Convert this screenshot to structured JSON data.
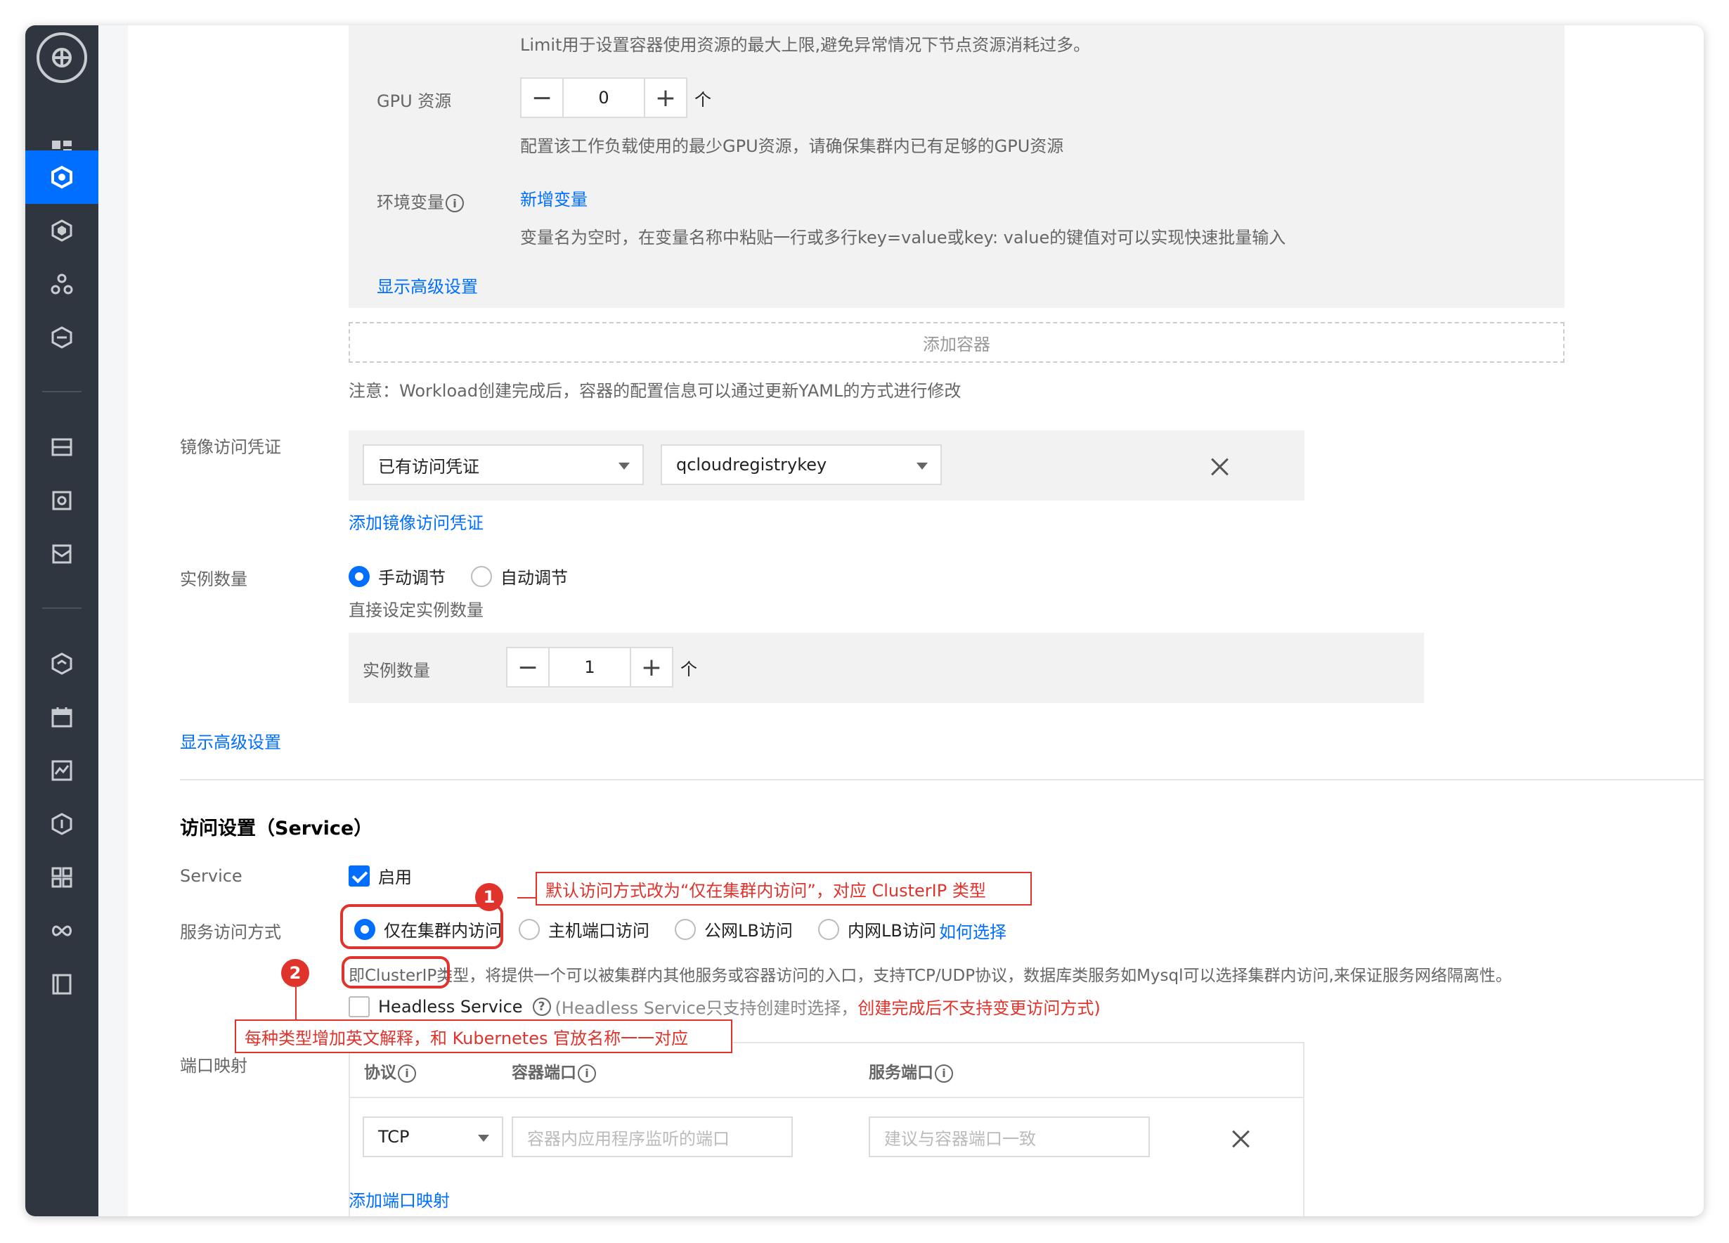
{
  "container": {
    "limit_note": "Limit用于设置容器使用资源的最大上限,避免异常情况下节点资源消耗过多。",
    "gpu_label": "GPU 资源",
    "gpu_value": "0",
    "gpu_unit": "个",
    "gpu_note": "配置该工作负载使用的最少GPU资源，请确保集群内已有足够的GPU资源",
    "env_label": "环境变量",
    "env_add": "新增变量",
    "env_note": "变量名为空时，在变量名称中粘贴一行或多行key=value或key: value的键值对可以实现快速批量输入",
    "advanced_link": "显示高级设置",
    "add_container": "添加容器",
    "workload_note": "注意：Workload创建完成后，容器的配置信息可以通过更新YAML的方式进行修改"
  },
  "registry": {
    "label": "镜像访问凭证",
    "select1": "已有访问凭证",
    "select2": "qcloudregistrykey",
    "add_link": "添加镜像访问凭证"
  },
  "instances": {
    "label": "实例数量",
    "manual": "手动调节",
    "auto": "自动调节",
    "note": "直接设定实例数量",
    "inner_label": "实例数量",
    "value": "1",
    "unit": "个",
    "advanced_link": "显示高级设置"
  },
  "service": {
    "section_title": "访问设置（Service）",
    "service_label": "Service",
    "enable_label": "启用",
    "access_label": "服务访问方式",
    "options": [
      "仅在集群内访问",
      "主机端口访问",
      "公网LB访问",
      "内网LB访问"
    ],
    "how_link": "如何选择",
    "desc_prefix": "即ClusterIP类型，",
    "desc_rest": "将提供一个可以被集群内其他服务或容器访问的入口，支持TCP/UDP协议，数据库类服务如Mysql可以选择集群内访问,来保证服务网络隔离性。",
    "headless_label": "Headless Service",
    "headless_note": "(Headless Service只支持创建时选择，",
    "headless_warn": "创建完成后不支持变更访问方式)",
    "port_label": "端口映射",
    "col_protocol": "协议",
    "col_container_port": "容器端口",
    "col_service_port": "服务端口",
    "protocol_value": "TCP",
    "container_port_placeholder": "容器内应用程序监听的端口",
    "service_port_placeholder": "建议与容器端口一致",
    "add_port_link": "添加端口映射"
  },
  "annotations": {
    "badge1": "1",
    "note1": "默认访问方式改为“仅在集群内访问”，对应 ClusterIP 类型",
    "badge2": "2",
    "note2": "每种类型增加英文解释，和 Kubernetes 官放名称一一对应"
  },
  "colors": {
    "accent": "#006eff",
    "sidebar": "#2f3640",
    "annotation": "#e0332c"
  }
}
